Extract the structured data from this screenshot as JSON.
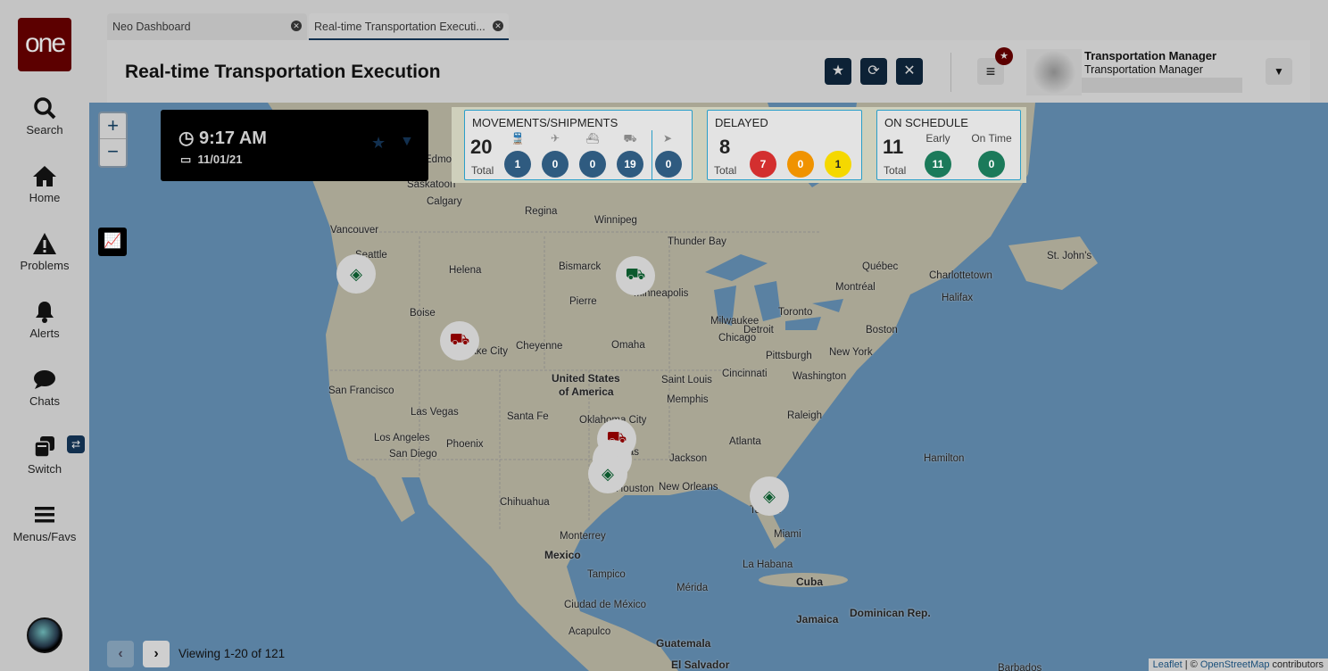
{
  "sidebar": {
    "logo": "one",
    "items": [
      {
        "label": "Search"
      },
      {
        "label": "Home"
      },
      {
        "label": "Problems"
      },
      {
        "label": "Alerts"
      },
      {
        "label": "Chats"
      },
      {
        "label": "Switch"
      },
      {
        "label": "Menus/Favs"
      }
    ]
  },
  "tabs": [
    {
      "label": "Neo Dashboard"
    },
    {
      "label": "Real-time Transportation Executi..."
    }
  ],
  "header": {
    "title": "Real-time Transportation Execution",
    "user_name": "Transportation Manager",
    "user_role": "Transportation Manager"
  },
  "clock": {
    "time": "9:17 AM",
    "date": "11/01/21"
  },
  "kpis": {
    "movements": {
      "title": "MOVEMENTS/SHIPMENTS",
      "total": "20",
      "total_label": "Total",
      "counts": [
        "1",
        "0",
        "0",
        "19",
        "0"
      ],
      "icons": [
        "rail-icon",
        "air-icon",
        "ocean-icon",
        "truck-icon",
        "parcel-icon"
      ]
    },
    "delayed": {
      "title": "DELAYED",
      "total": "8",
      "total_label": "Total",
      "counts": [
        "7",
        "0",
        "1"
      ],
      "colors": [
        "#d32f2f",
        "#f09300",
        "#f5d800"
      ]
    },
    "on_schedule": {
      "title": "ON SCHEDULE",
      "total": "11",
      "total_label": "Total",
      "early_label": "Early",
      "early": "11",
      "on_time_label": "On Time",
      "on_time": "0"
    }
  },
  "map": {
    "labels": [
      "Edmonton",
      "Saskatoon",
      "Calgary",
      "Regina",
      "Winnipeg",
      "Vancouver",
      "Seattle",
      "Thunder Bay",
      "St. John's",
      "Québec",
      "Montréal",
      "Charlottetown",
      "Halifax",
      "Helena",
      "Bismarck",
      "Minneapolis",
      "Pierre",
      "Boise",
      "Toronto",
      "Milwaukee",
      "Chicago",
      "Detroit",
      "Boston",
      "Salt Lake City",
      "Cheyenne",
      "Omaha",
      "Pittsburgh",
      "New York",
      "United States",
      "of America",
      "Cincinnati",
      "Washington",
      "San Francisco",
      "Saint Louis",
      "Las Vegas",
      "Santa Fe",
      "Oklahoma City",
      "Memphis",
      "Raleigh",
      "Los Angeles",
      "Phoenix",
      "San Diego",
      "Atlanta",
      "Hamilton",
      "Dallas",
      "Jackson",
      "Houston",
      "New Orleans",
      "Chihuahua",
      "Tampa",
      "Miami",
      "Monterrey",
      "Mexico",
      "La Habana",
      "Tampico",
      "Cuba",
      "Mérida",
      "Ciudad de México",
      "Jamaica",
      "Dominican Rep.",
      "Acapulco",
      "Guatemala",
      "El Salvador",
      "Barbados"
    ],
    "attribution": {
      "leaflet": "Leaflet",
      "sep": " | © ",
      "osm": "OpenStreetMap",
      "suffix": " contributors"
    }
  },
  "pager": {
    "text": "Viewing 1-20 of 121"
  },
  "colors": {
    "navy": "#0d2236",
    "pill": "#2f5b80",
    "green": "#1b7a5a",
    "brand": "#5c0000"
  }
}
